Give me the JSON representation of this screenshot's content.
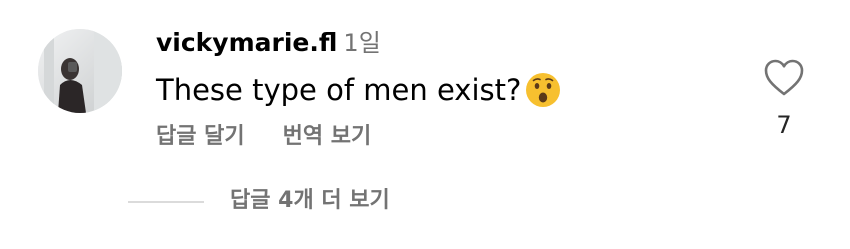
{
  "comment": {
    "username": "vickymarie.fl",
    "timestamp": "1일",
    "text": "These type of men exist?",
    "emoji": "hushed-face-emoji",
    "actions": {
      "reply_label": "답글 달기",
      "translate_label": "번역 보기"
    },
    "like": {
      "icon": "heart-outline-icon",
      "count": "7"
    },
    "replies_label": "답글 4개 더 보기"
  },
  "colors": {
    "primary_text": "#000000",
    "secondary_text": "#737373",
    "divider": "#dbdbdb",
    "emoji_face": "#f7c02f"
  }
}
